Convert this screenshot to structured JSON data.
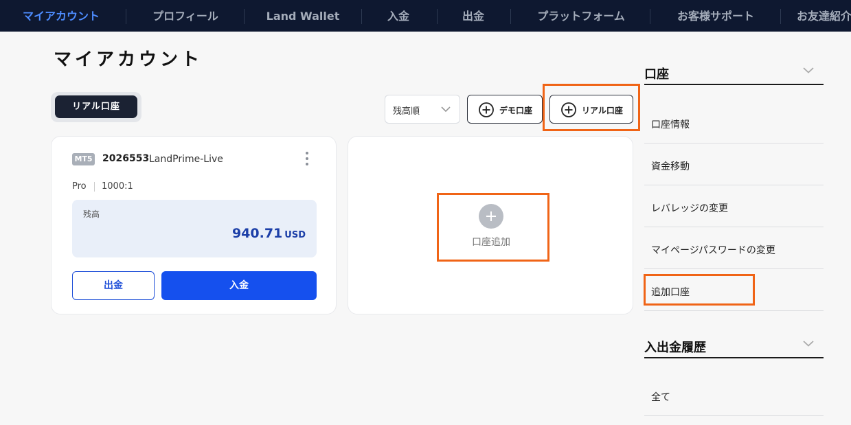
{
  "nav": {
    "tabs": [
      {
        "label": "マイアカウント"
      },
      {
        "label": "プロフィール"
      },
      {
        "label": "Land Wallet"
      },
      {
        "label": "入金"
      },
      {
        "label": "出金"
      },
      {
        "label": "プラットフォーム"
      },
      {
        "label": "お客様サポート"
      },
      {
        "label": "お友達紹介"
      }
    ]
  },
  "page": {
    "title": "マイアカウント"
  },
  "account_filter": {
    "active_label": "リアル口座"
  },
  "toolbar": {
    "sort_value": "残高順",
    "add_demo_label": "デモ口座",
    "add_real_label": "リアル口座"
  },
  "account_card": {
    "badge": "MT5",
    "number": "2026553",
    "server": "LandPrime-Live",
    "type": "Pro",
    "leverage": "1000:1",
    "balance_label": "残高",
    "balance_value": "940.71",
    "balance_currency": "USD",
    "withdraw_label": "出金",
    "deposit_label": "入金"
  },
  "add_account_card": {
    "label": "口座追加"
  },
  "sidebar": {
    "sections": [
      {
        "title": "口座",
        "items": [
          {
            "label": "口座情報"
          },
          {
            "label": "資金移動"
          },
          {
            "label": "レバレッジの変更"
          },
          {
            "label": "マイページパスワードの変更"
          },
          {
            "label": "追加口座"
          }
        ]
      },
      {
        "title": "入出金履歴",
        "items": [
          {
            "label": "全て"
          }
        ]
      }
    ]
  },
  "colors": {
    "nav_bg": "#0e1830",
    "nav_active": "#4d8cff",
    "primary": "#1550ee",
    "highlight": "#f06416",
    "balance_text": "#1c3fa8"
  }
}
